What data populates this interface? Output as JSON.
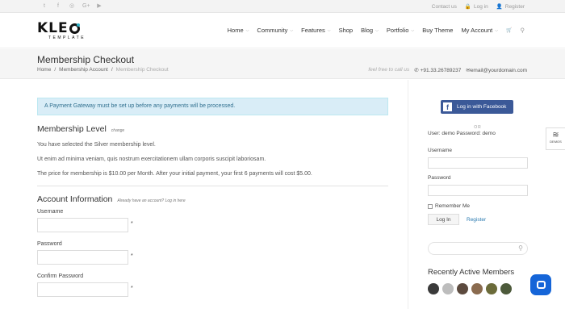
{
  "topbar": {
    "social": [
      "twitter-icon",
      "facebook-icon",
      "dribbble-icon",
      "google-plus-icon",
      "youtube-icon"
    ],
    "social_glyphs": [
      "t",
      "f",
      "◎",
      "G+",
      "▶"
    ],
    "contact_us": "Contact us",
    "login": "Log in",
    "register": "Register"
  },
  "logo": {
    "main": "KLE",
    "sub": "TEMPLATE"
  },
  "nav": {
    "items": [
      {
        "label": "Home",
        "dropdown": true
      },
      {
        "label": "Community",
        "dropdown": true
      },
      {
        "label": "Features",
        "dropdown": true
      },
      {
        "label": "Shop",
        "dropdown": false
      },
      {
        "label": "Blog",
        "dropdown": true
      },
      {
        "label": "Portfolio",
        "dropdown": true
      },
      {
        "label": "Buy Theme",
        "dropdown": false
      },
      {
        "label": "My Account",
        "dropdown": true
      }
    ],
    "cart_glyph": "🛒",
    "search_glyph": "⚲"
  },
  "page": {
    "title": "Membership Checkout",
    "breadcrumb": [
      "Home",
      "Membership Account",
      "Membership Checkout"
    ],
    "feel_free": "feel free to call us",
    "phone": "+91.33.26789237",
    "email": "email@yourdomain.com"
  },
  "main": {
    "alert": "A Payment Gateway must be set up before any payments will be processed.",
    "level_heading": "Membership Level",
    "level_change": "change",
    "p1": "You have selected the Silver membership level.",
    "p2": "Ut enim ad minima veniam, quis nostrum exercitationem ullam corporis suscipit laboriosam.",
    "p3": "The price for membership is $10.00 per Month. After your initial payment, your first 6 payments will cost $5.00.",
    "account_heading": "Account Information",
    "account_note": "Already have an account? Log in here",
    "username_label": "Username",
    "password_label": "Password",
    "confirm_label": "Confirm Password",
    "required": "*"
  },
  "sidebar": {
    "facebook_btn": "Log in with Facebook",
    "or": "OR",
    "demo_user": "User: demo Password: demo",
    "username_label": "Username",
    "password_label": "Password",
    "remember": "Remember Me",
    "login_btn": "Log In",
    "register_link": "Register",
    "search_glyph": "⚲",
    "recent_heading": "Recently Active Members",
    "avatars": [
      "#3a3a3a",
      "#bdbdbd",
      "#5c4a3e",
      "#8a6b4f",
      "#6b6b3a",
      "#4d5a3b"
    ]
  },
  "demos": {
    "label": "DEMOS"
  }
}
